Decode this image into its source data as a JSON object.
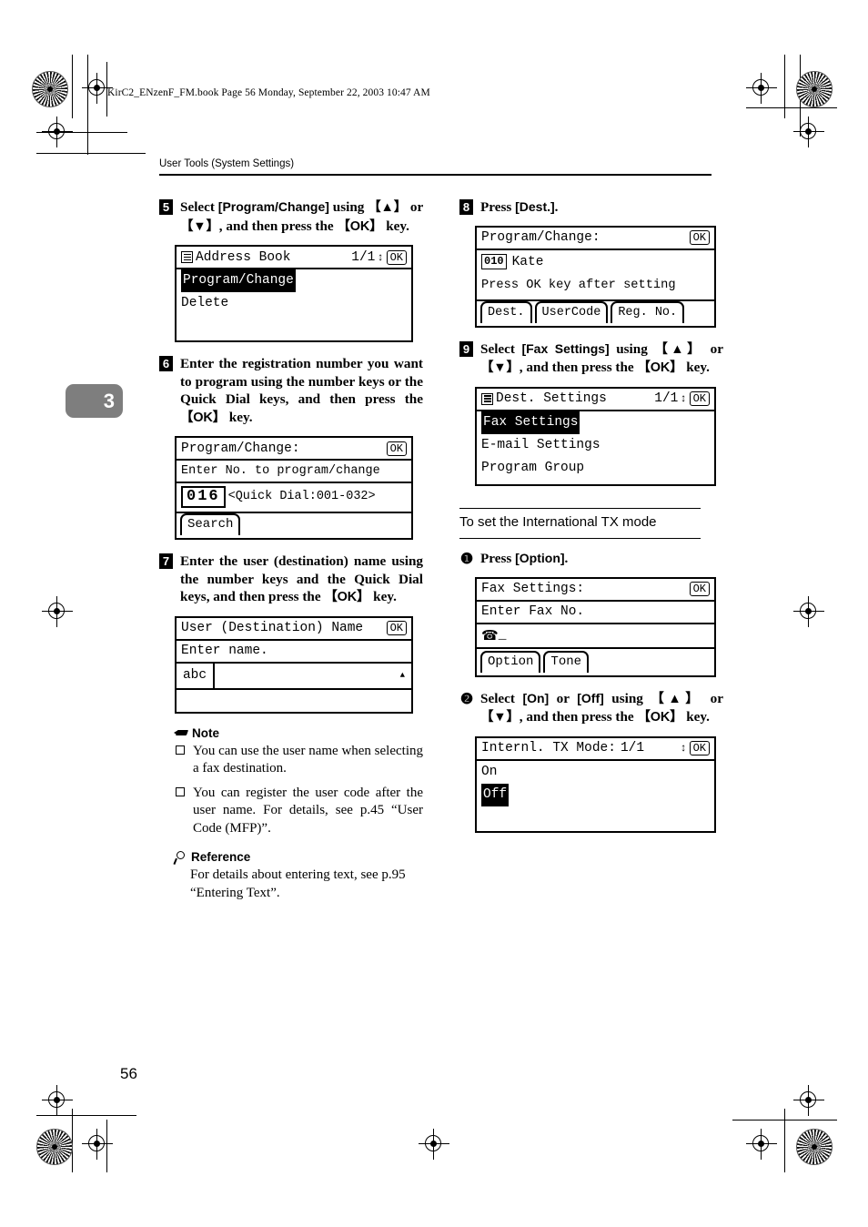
{
  "book_line": "KirC2_ENzenF_FM.book   Page 56   Monday, September 22, 2003   10:47 AM",
  "running_head": "User Tools (System Settings)",
  "chapter_tab": "3",
  "folio": "56",
  "left_column": {
    "step5": {
      "num": "5",
      "text_parts": {
        "a": "Select ",
        "b": "[Program/Change]",
        "c": " using ",
        "d": "【▲】",
        "e": " or ",
        "f": "【▼】",
        "g": ", and then press the ",
        "h": "【OK】",
        "i": " key."
      },
      "lcd": {
        "title": "Address Book",
        "page": "1/1",
        "ok": "OK",
        "items": [
          {
            "label": "Program/Change",
            "selected": true
          },
          {
            "label": "Delete",
            "selected": false
          }
        ]
      }
    },
    "step6": {
      "num": "6",
      "text_parts": {
        "a": "Enter the registration number you want to program using the number keys or the Quick Dial keys, and then press the ",
        "b": "【OK】",
        "c": " key."
      },
      "lcd": {
        "title": "Program/Change:",
        "ok": "OK",
        "prompt": "Enter No. to program/change",
        "value": "016",
        "hint": "<Quick Dial:001-032>",
        "tab": "Search"
      }
    },
    "step7": {
      "num": "7",
      "text_parts": {
        "a": "Enter the user (destination) name using the number keys and the Quick Dial keys, and then press the ",
        "b": "【OK】",
        "c": " key."
      },
      "lcd": {
        "title": "User (Destination) Name",
        "ok": "OK",
        "prompt": "Enter name.",
        "mode": "abc",
        "field_value": "",
        "caret": "▲"
      }
    },
    "note": {
      "heading": "Note",
      "items": [
        "You can use the user name when selecting a fax destination.",
        "You can register the user code after the user name. For details, see p.45 “User Code (MFP)”."
      ]
    },
    "reference": {
      "heading": "Reference",
      "body": "For details about entering text, see p.95 “Entering Text”."
    }
  },
  "right_column": {
    "step8": {
      "num": "8",
      "text_parts": {
        "a": "Press ",
        "b": "[Dest.]",
        "c": "."
      },
      "lcd": {
        "title": "Program/Change:",
        "ok": "OK",
        "reg_no": "010",
        "name": "Kate",
        "prompt": "Press OK key after setting",
        "tabs": [
          "Dest.",
          "UserCode",
          "Reg. No."
        ]
      }
    },
    "step9": {
      "num": "9",
      "text_parts": {
        "a": "Select ",
        "b": "[Fax Settings]",
        "c": " using ",
        "d": "【▲】",
        "e": " or ",
        "f": "【▼】",
        "g": ", and then press the ",
        "h": "【OK】",
        "i": " key."
      },
      "lcd": {
        "title": "Dest. Settings",
        "page": "1/1",
        "ok": "OK",
        "items": [
          {
            "label": "Fax Settings",
            "selected": true
          },
          {
            "label": "E-mail Settings",
            "selected": false
          },
          {
            "label": "Program Group",
            "selected": false
          }
        ]
      }
    },
    "subsection": {
      "heading": "To set the International TX mode"
    },
    "substep1": {
      "num": "❶",
      "text_parts": {
        "a": "Press ",
        "b": "[Option]",
        "c": "."
      },
      "lcd": {
        "title": "Fax Settings:",
        "ok": "OK",
        "prompt": "Enter Fax No.",
        "phone_icon": "☎",
        "field_value": "_",
        "tabs": [
          "Option",
          "Tone"
        ]
      }
    },
    "substep2": {
      "num": "❷",
      "text_parts": {
        "a": "Select ",
        "b": "[On]",
        "c": " or ",
        "d": "[Off]",
        "e": " using ",
        "f": "【▲】",
        "g": " or ",
        "h": "【▼】",
        "i": ", and then press the ",
        "j": "【OK】",
        "k": " key."
      },
      "lcd": {
        "title": "Internl. TX Mode:",
        "page": "1/1",
        "ok": "OK",
        "items": [
          {
            "label": "On",
            "selected": false
          },
          {
            "label": "Off",
            "selected": true
          }
        ]
      }
    }
  }
}
